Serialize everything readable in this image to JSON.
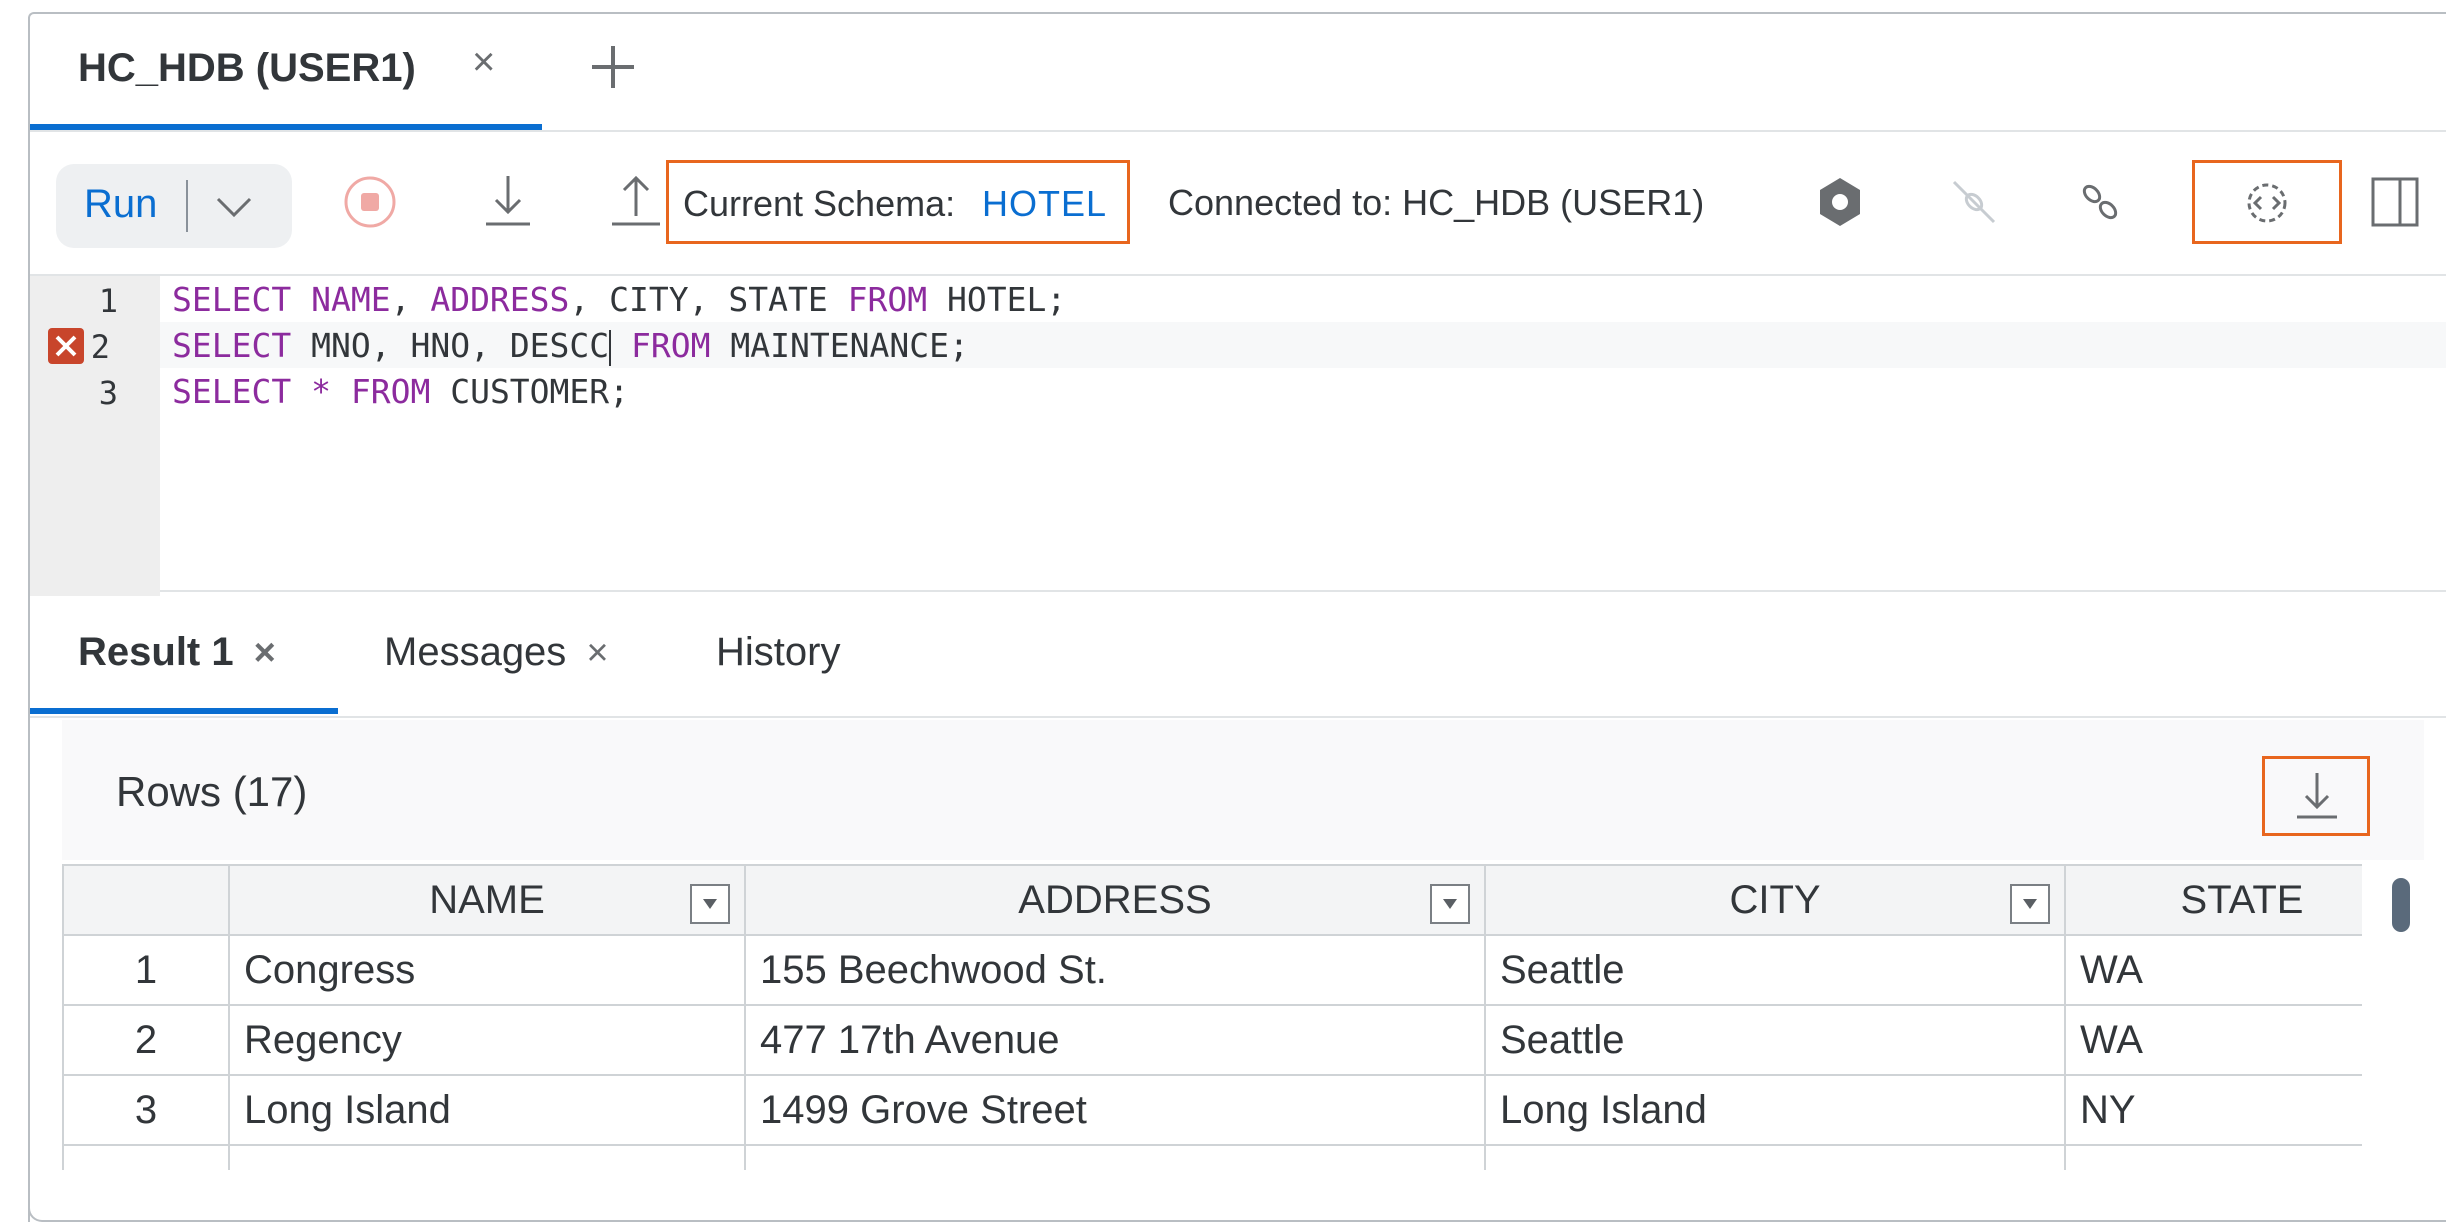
{
  "editor_tab": {
    "title": "HC_HDB (USER1)",
    "close": "×"
  },
  "toolbar": {
    "run_label": "Run",
    "schema_label": "Current Schema:",
    "schema_value": "HOTEL",
    "connected_label": "Connected to: HC_HDB (USER1)"
  },
  "code": {
    "line_numbers": [
      "1",
      "2",
      "3"
    ],
    "lines": [
      "SELECT NAME, ADDRESS, CITY, STATE FROM HOTEL;",
      "SELECT MNO, HNO, DESCC FROM MAINTENANCE;",
      "SELECT * FROM CUSTOMER;"
    ],
    "error_line": 2
  },
  "result_tabs": [
    {
      "label": "Result 1",
      "close": "×",
      "active": true
    },
    {
      "label": "Messages",
      "close": "×",
      "active": false
    },
    {
      "label": "History",
      "active": false
    }
  ],
  "result": {
    "rows_label": "Rows (17)",
    "columns": [
      "NAME",
      "ADDRESS",
      "CITY",
      "STATE"
    ],
    "rows": [
      [
        "1",
        "Congress",
        "155 Beechwood St.",
        "Seattle",
        "WA"
      ],
      [
        "2",
        "Regency",
        "477 17th Avenue",
        "Seattle",
        "WA"
      ],
      [
        "3",
        "Long Island",
        "1499 Grove Street",
        "Long Island",
        "NY"
      ],
      [
        "",
        "",
        "",
        "",
        ""
      ]
    ]
  },
  "colors": {
    "accent": "#0a6ed1",
    "highlight": "#e8661e",
    "keyword": "#8c2b9e",
    "error": "#c8452b"
  }
}
